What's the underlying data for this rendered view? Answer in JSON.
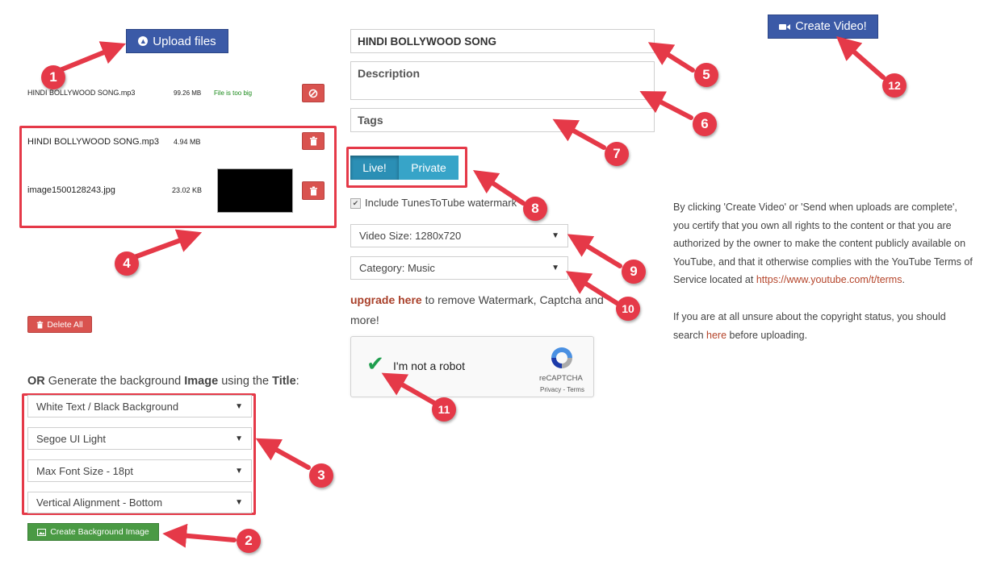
{
  "upload": {
    "label": "Upload files"
  },
  "files": [
    {
      "name": "HINDI BOLLYWOOD SONG.mp3",
      "size": "99.26 MB",
      "status": "File is too big"
    },
    {
      "name": "HINDI BOLLYWOOD SONG.mp3",
      "size": "4.94 MB"
    },
    {
      "name": "image1500128243.jpg",
      "size": "23.02 KB"
    }
  ],
  "delete_all": "Delete All",
  "generate": {
    "prefix": "OR",
    "middle": " Generate the background ",
    "image_word": "Image",
    "middle2": " using the ",
    "title_word": "Title",
    "suffix": ":"
  },
  "bg_options": [
    "White Text / Black Background",
    "Segoe UI Light",
    "Max Font Size - 18pt",
    "Vertical Alignment - Bottom"
  ],
  "create_bg": "Create Background Image",
  "form": {
    "title_value": "HINDI BOLLYWOOD SONG",
    "description_placeholder": "Description",
    "tags_placeholder": "Tags"
  },
  "privacy": {
    "live": "Live!",
    "private": "Private"
  },
  "watermark_label": "Include TunesToTube watermark",
  "video_size": "Video Size: 1280x720",
  "category": "Category: Music",
  "upgrade": {
    "link": "upgrade here",
    "rest": " to remove Watermark, Captcha and",
    "line2": "more!"
  },
  "captcha": {
    "label": "I'm not a robot",
    "brand": "reCAPTCHA",
    "links": "Privacy - Terms"
  },
  "create_video": "Create Video!",
  "terms": {
    "p1": "By clicking 'Create Video' or 'Send when uploads are complete', you certify that you own all rights to the content or that you are authorized by the owner to make the content publicly available on YouTube, and that it otherwise complies with the YouTube Terms of Service located at ",
    "p1_link": "https://www.youtube.com/t/terms",
    "p1_end": ".",
    "p2_start": "If you are at all unsure about the copyright status, you should search ",
    "p2_link": "here",
    "p2_end": " before uploading."
  },
  "annotations": [
    "1",
    "2",
    "3",
    "4",
    "5",
    "6",
    "7",
    "8",
    "9",
    "10",
    "11",
    "12"
  ],
  "colors": {
    "primary_blue": "#3b5aa7",
    "danger_red": "#d9534f",
    "success_green": "#4a9a44",
    "toggle_teal": "#37a4c8",
    "annotation_red": "#e53948",
    "status_green": "#1a8a1a",
    "link_red": "#b5452b"
  }
}
